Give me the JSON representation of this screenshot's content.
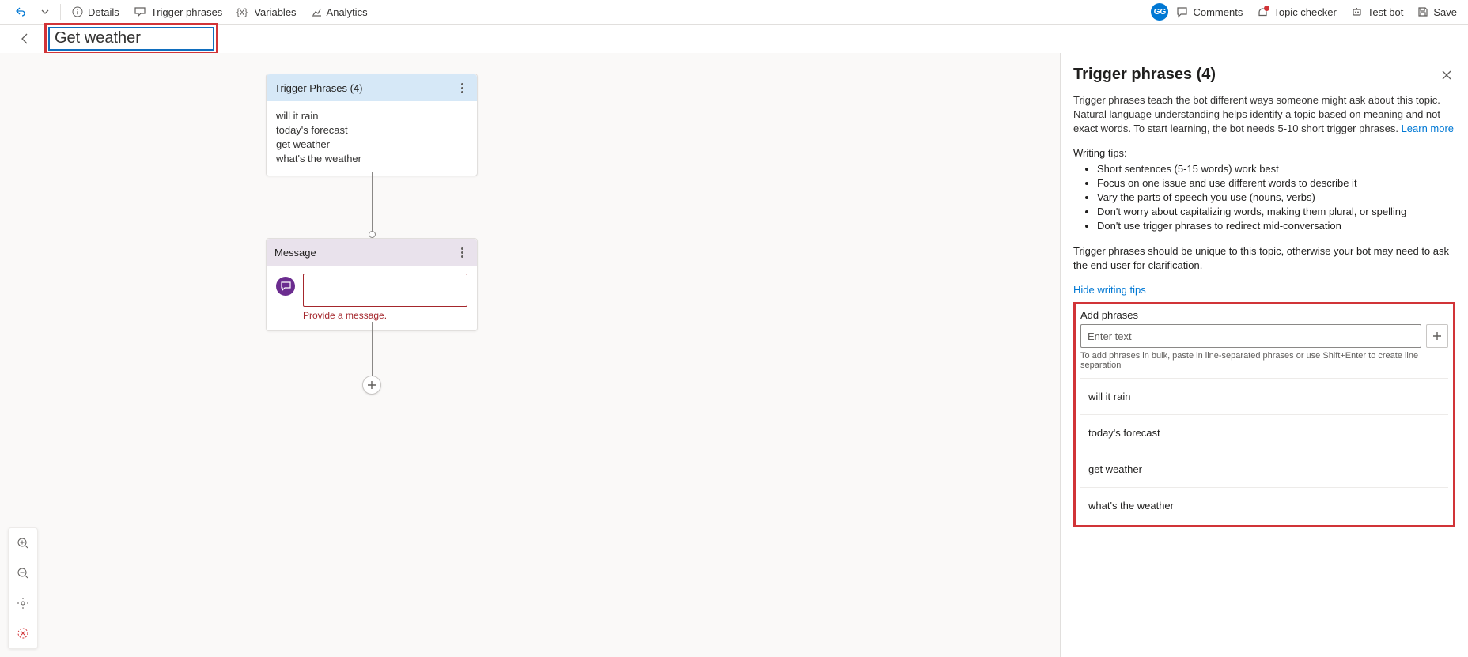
{
  "toolbar": {
    "details": "Details",
    "trigger_phrases": "Trigger phrases",
    "variables": "Variables",
    "analytics": "Analytics",
    "avatar": "GG",
    "comments": "Comments",
    "topic_checker": "Topic checker",
    "test_bot": "Test bot",
    "save": "Save"
  },
  "title": {
    "value": "Get weather"
  },
  "canvas": {
    "trigger_node": {
      "title": "Trigger Phrases (4)",
      "phrases": [
        "will it rain",
        "today's forecast",
        "get weather",
        "what's the weather"
      ]
    },
    "message_node": {
      "title": "Message",
      "error": "Provide a message."
    }
  },
  "panel": {
    "title": "Trigger phrases (4)",
    "description": "Trigger phrases teach the bot different ways someone might ask about this topic. Natural language understanding helps identify a topic based on meaning and not exact words. To start learning, the bot needs 5-10 short trigger phrases.",
    "learn_more": "Learn more",
    "tips_heading": "Writing tips:",
    "tips": [
      "Short sentences (5-15 words) work best",
      "Focus on one issue and use different words to describe it",
      "Vary the parts of speech you use (nouns, verbs)",
      "Don't worry about capitalizing words, making them plural, or spelling",
      "Don't use trigger phrases to redirect mid-conversation"
    ],
    "unique_note": "Trigger phrases should be unique to this topic, otherwise your bot may need to ask the end user for clarification.",
    "hide_tips": "Hide writing tips",
    "add_phrases_label": "Add phrases",
    "add_placeholder": "Enter text",
    "bulk_hint": "To add phrases in bulk, paste in line-separated phrases or use Shift+Enter to create line separation",
    "list": [
      "will it rain",
      "today's forecast",
      "get weather",
      "what's the weather"
    ]
  }
}
